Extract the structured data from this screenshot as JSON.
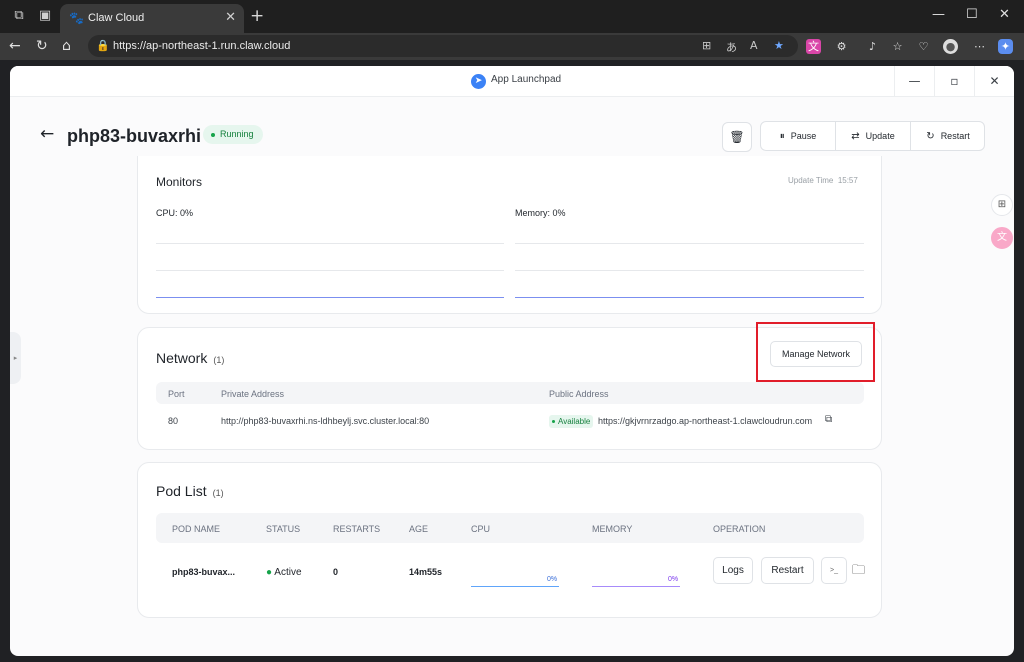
{
  "browser": {
    "tab_title": "Claw Cloud",
    "url": "https://ap-northeast-1.run.claw.cloud"
  },
  "app_window": {
    "title": "App Launchpad"
  },
  "header": {
    "app_name": "php83-buvaxrhi",
    "status": "Running",
    "actions": {
      "pause": "Pause",
      "update": "Update",
      "restart": "Restart"
    }
  },
  "monitors": {
    "title": "Monitors",
    "update_time_label": "Update Time",
    "update_time": "15:57",
    "cpu_label": "CPU:",
    "cpu_value": "0%",
    "memory_label": "Memory:",
    "memory_value": "0%"
  },
  "network": {
    "title": "Network",
    "count": "(1)",
    "manage_label": "Manage Network",
    "columns": [
      "Port",
      "Private Address",
      "Public Address"
    ],
    "rows": [
      {
        "port": "80",
        "private_address": "http://php83-buvaxrhi.ns-ldhbeylj.svc.cluster.local:80",
        "status": "Available",
        "public_address": "https://gkjvrnrzadgo.ap-northeast-1.clawcloudrun.com"
      }
    ]
  },
  "pods": {
    "title": "Pod List",
    "count": "(1)",
    "columns": [
      "POD NAME",
      "STATUS",
      "RESTARTS",
      "AGE",
      "CPU",
      "MEMORY",
      "OPERATION"
    ],
    "rows": [
      {
        "name": "php83-buvax...",
        "status": "Active",
        "restarts": "0",
        "age": "14m55s",
        "cpu": "0%",
        "memory": "0%",
        "logs_label": "Logs",
        "restart_label": "Restart",
        "terminal_label": ">_"
      }
    ]
  },
  "colors": {
    "accent_blue": "#3b82f6",
    "status_green": "#16a34a",
    "highlight_red": "#e11d2a"
  }
}
